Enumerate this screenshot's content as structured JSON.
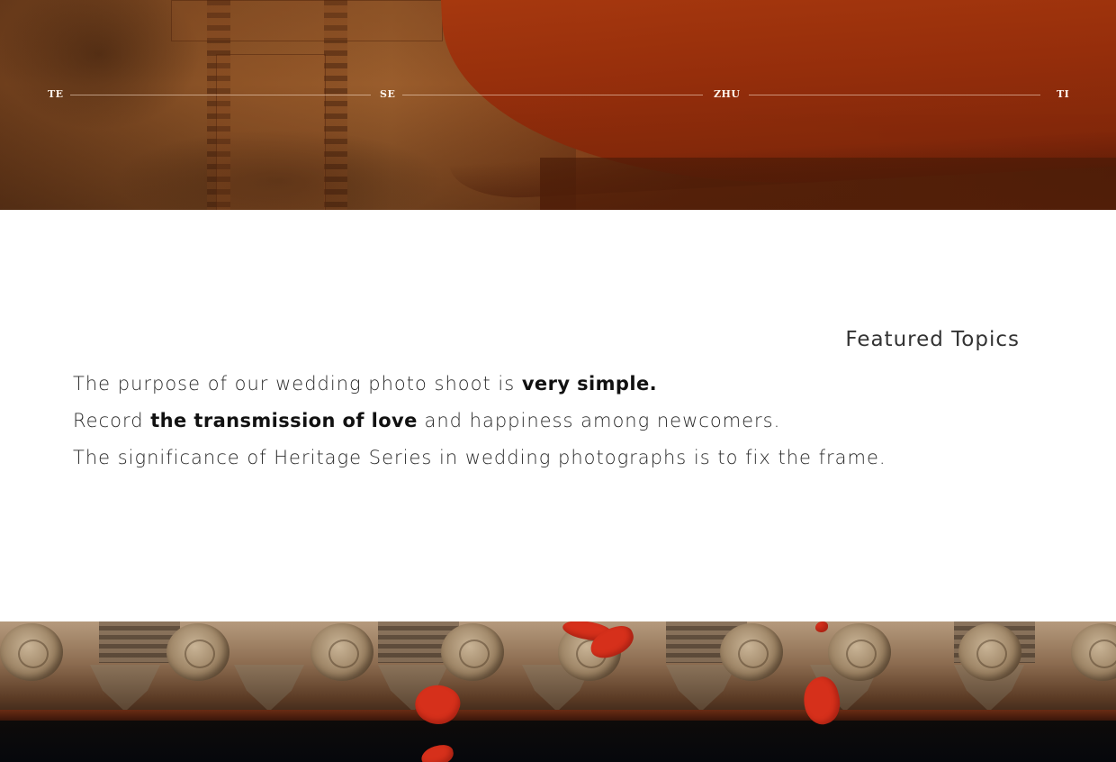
{
  "topic_nav": {
    "items": [
      {
        "label": "TE"
      },
      {
        "label": "SE"
      },
      {
        "label": "ZHU"
      },
      {
        "label": "TI"
      }
    ]
  },
  "section": {
    "title": "Featured Topics"
  },
  "statement": {
    "line1": {
      "text": "The purpose of our wedding photo shoot is ",
      "bold": "very simple."
    },
    "line2": {
      "pre": "Record ",
      "bold": "the transmission of love",
      "post": " and happiness among newcomers."
    },
    "line3": {
      "text": "The significance of Heritage Series in wedding photographs is to fix the frame."
    }
  },
  "colors": {
    "umbrella_red": "#a8380e",
    "petal_red": "#d6301b",
    "text_dark": "#2a2a2a"
  }
}
